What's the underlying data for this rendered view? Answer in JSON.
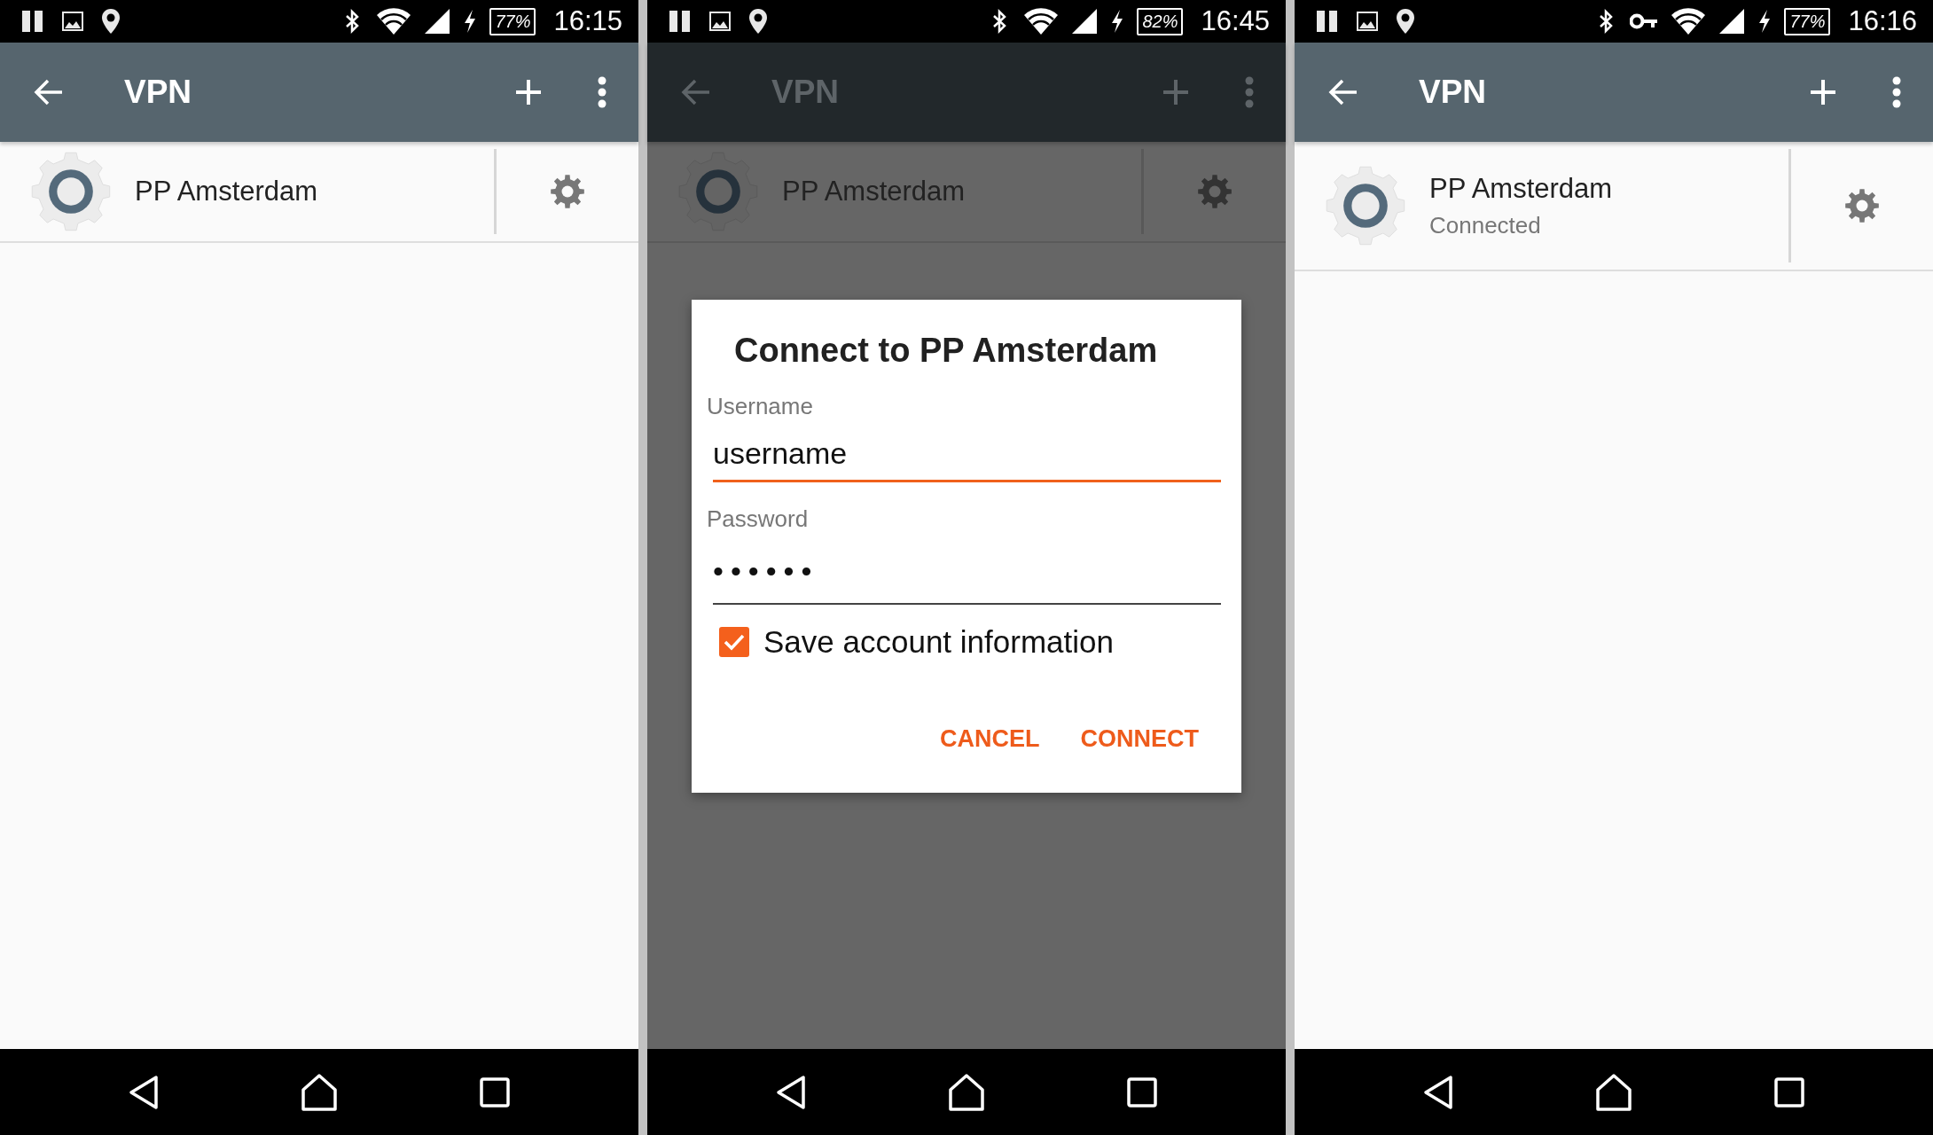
{
  "screens": [
    {
      "status_bar": {
        "vpn_key": false,
        "battery": "77%",
        "time": "16:15"
      },
      "toolbar": {
        "title": "VPN"
      },
      "dimmed": false,
      "vpn_list": [
        {
          "name": "PP Amsterdam"
        }
      ]
    },
    {
      "status_bar": {
        "vpn_key": false,
        "battery": "82%",
        "time": "16:45"
      },
      "toolbar": {
        "title": "VPN"
      },
      "dimmed": true,
      "vpn_list": [
        {
          "name": "PP Amsterdam"
        }
      ],
      "dialog": {
        "title": "Connect to PP Amsterdam",
        "fields": [
          {
            "label": "Username",
            "value": "username",
            "focused": true
          },
          {
            "label": "Password",
            "value": "••••••",
            "focused": false
          }
        ],
        "checkbox": {
          "label": "Save account information",
          "checked": true
        },
        "buttons": [
          "CANCEL",
          "CONNECT"
        ]
      }
    },
    {
      "status_bar": {
        "vpn_key": true,
        "battery": "77%",
        "time": "16:16"
      },
      "toolbar": {
        "title": "VPN"
      },
      "dimmed": false,
      "vpn_list": [
        {
          "name": "PP Amsterdam",
          "status": "Connected"
        }
      ]
    }
  ]
}
